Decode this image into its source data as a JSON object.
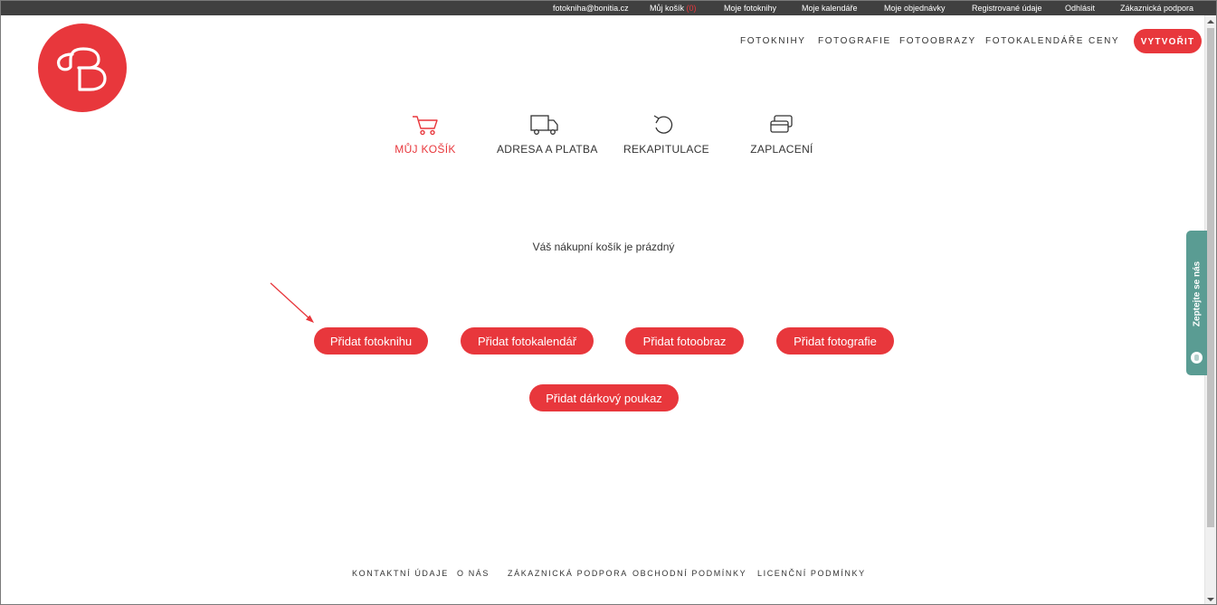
{
  "topbar": {
    "email": "fotokniha@bonitia.cz",
    "cart_label": "Můj košík",
    "cart_count": "(0)",
    "my_photobooks": "Moje fotoknihy",
    "my_calendars": "Moje kalendáře",
    "my_orders": "Moje objednávky",
    "registered_data": "Registrované údaje",
    "logout": "Odhlásit",
    "support": "Zákaznická podpora"
  },
  "nav": {
    "photobooks": "FOTOKNIHY",
    "photos": "FOTOGRAFIE",
    "photo_pictures": "FOTOOBRAZY",
    "photo_calendars": "FOTOKALENDÁŘE",
    "prices": "CENY",
    "create": "VYTVOŘIT"
  },
  "steps": [
    {
      "label": "MŮJ KOŠÍK",
      "icon": "cart-icon",
      "active": true
    },
    {
      "label": "ADRESA A PLATBA",
      "icon": "truck-icon",
      "active": false
    },
    {
      "label": "REKAPITULACE",
      "icon": "refresh-icon",
      "active": false
    },
    {
      "label": "ZAPLACENÍ",
      "icon": "payment-cards-icon",
      "active": false
    }
  ],
  "cart": {
    "empty_message": "Váš nákupní košík je prázdný"
  },
  "buttons": {
    "add_photobook": "Přidat fotoknihu",
    "add_calendar": "Přidat fotokalendář",
    "add_picture": "Přidat fotoobraz",
    "add_photos": "Přidat fotografie",
    "add_voucher": "Přidat dárkový poukaz"
  },
  "side_widget": {
    "label": "Zeptejte se nás"
  },
  "footer": {
    "contact": "KONTAKTNÍ ÚDAJE",
    "about": "O NÁS",
    "support": "ZÁKAZNICKÁ PODPORA",
    "terms": "OBCHODNÍ PODMÍNKY",
    "license": "LICENČNÍ PODMÍNKY"
  },
  "colors": {
    "accent": "#e8373c",
    "topbar": "#404040",
    "widget": "#5a9c93"
  }
}
